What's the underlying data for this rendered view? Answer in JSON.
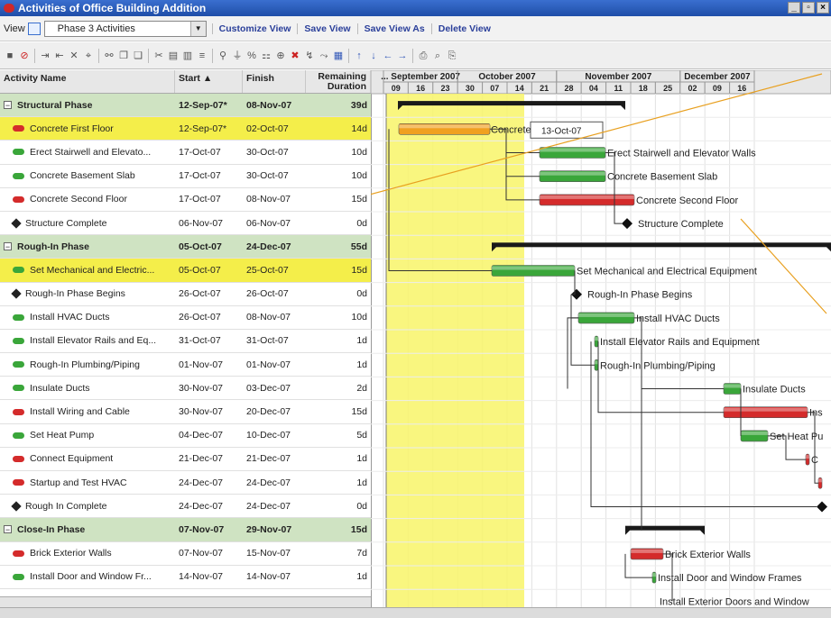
{
  "window": {
    "title": "Activities of Office Building Addition"
  },
  "view": {
    "label": "View",
    "selected": "Phase 3 Activities",
    "links": [
      "Customize View",
      "Save View",
      "Save View As",
      "Delete View"
    ]
  },
  "columns": {
    "activity": "Activity Name",
    "start": "Start",
    "finish": "Finish",
    "remaining": "Remaining Duration"
  },
  "rows": [
    {
      "type": "phase",
      "name": "Structural Phase",
      "start": "12-Sep-07*",
      "finish": "08-Nov-07",
      "dur": "39d"
    },
    {
      "type": "task",
      "icon": "red",
      "name": "Concrete First Floor",
      "start": "12-Sep-07*",
      "finish": "02-Oct-07",
      "dur": "14d",
      "selected": true
    },
    {
      "type": "task",
      "icon": "green",
      "name": "Erect Stairwell and Elevato...",
      "start": "17-Oct-07",
      "finish": "30-Oct-07",
      "dur": "10d"
    },
    {
      "type": "task",
      "icon": "green",
      "name": "Concrete Basement Slab",
      "start": "17-Oct-07",
      "finish": "30-Oct-07",
      "dur": "10d"
    },
    {
      "type": "task",
      "icon": "red",
      "name": "Concrete Second Floor",
      "start": "17-Oct-07",
      "finish": "08-Nov-07",
      "dur": "15d"
    },
    {
      "type": "task",
      "icon": "ms",
      "name": "Structure Complete",
      "start": "06-Nov-07",
      "finish": "06-Nov-07",
      "dur": "0d"
    },
    {
      "type": "phase",
      "name": "Rough-In Phase",
      "start": "05-Oct-07",
      "finish": "24-Dec-07",
      "dur": "55d"
    },
    {
      "type": "task",
      "icon": "green",
      "name": "Set Mechanical and Electric...",
      "start": "05-Oct-07",
      "finish": "25-Oct-07",
      "dur": "15d",
      "selected": true
    },
    {
      "type": "task",
      "icon": "ms",
      "name": "Rough-In Phase Begins",
      "start": "26-Oct-07",
      "finish": "26-Oct-07",
      "dur": "0d"
    },
    {
      "type": "task",
      "icon": "green",
      "name": "Install HVAC Ducts",
      "start": "26-Oct-07",
      "finish": "08-Nov-07",
      "dur": "10d"
    },
    {
      "type": "task",
      "icon": "green",
      "name": "Install Elevator Rails and Eq...",
      "start": "31-Oct-07",
      "finish": "31-Oct-07",
      "dur": "1d"
    },
    {
      "type": "task",
      "icon": "green",
      "name": "Rough-In Plumbing/Piping",
      "start": "01-Nov-07",
      "finish": "01-Nov-07",
      "dur": "1d"
    },
    {
      "type": "task",
      "icon": "green",
      "name": "Insulate Ducts",
      "start": "30-Nov-07",
      "finish": "03-Dec-07",
      "dur": "2d"
    },
    {
      "type": "task",
      "icon": "red",
      "name": "Install Wiring and Cable",
      "start": "30-Nov-07",
      "finish": "20-Dec-07",
      "dur": "15d"
    },
    {
      "type": "task",
      "icon": "green",
      "name": "Set Heat Pump",
      "start": "04-Dec-07",
      "finish": "10-Dec-07",
      "dur": "5d"
    },
    {
      "type": "task",
      "icon": "red",
      "name": "Connect Equipment",
      "start": "21-Dec-07",
      "finish": "21-Dec-07",
      "dur": "1d"
    },
    {
      "type": "task",
      "icon": "red",
      "name": "Startup and Test HVAC",
      "start": "24-Dec-07",
      "finish": "24-Dec-07",
      "dur": "1d"
    },
    {
      "type": "task",
      "icon": "ms",
      "name": "Rough In Complete",
      "start": "24-Dec-07",
      "finish": "24-Dec-07",
      "dur": "0d"
    },
    {
      "type": "phase",
      "name": "Close-In Phase",
      "start": "07-Nov-07",
      "finish": "29-Nov-07",
      "dur": "15d"
    },
    {
      "type": "task",
      "icon": "red",
      "name": "Brick Exterior Walls",
      "start": "07-Nov-07",
      "finish": "15-Nov-07",
      "dur": "7d"
    },
    {
      "type": "task",
      "icon": "green",
      "name": "Install Door and Window Fr...",
      "start": "14-Nov-07",
      "finish": "14-Nov-07",
      "dur": "1d"
    }
  ],
  "timeline": {
    "months": [
      {
        "label": "... September 2007",
        "weeks": [
          "09",
          "16",
          "23"
        ]
      },
      {
        "label": "October 2007",
        "weeks": [
          "30",
          "07",
          "14",
          "21"
        ]
      },
      {
        "label": "November 2007",
        "weeks": [
          "28",
          "04",
          "11",
          "18",
          "25"
        ]
      },
      {
        "label": "December 2007",
        "weeks": [
          "02",
          "09",
          "16"
        ]
      }
    ]
  },
  "gantt_labels": [
    "Concrete",
    "13-Oct-07",
    "Erect Stairwell and Elevator Walls",
    "Concrete Basement Slab",
    "Concrete Second Floor",
    "Structure Complete",
    "Set Mechanical and Electrical Equipment",
    "Rough-In Phase Begins",
    "Install HVAC Ducts",
    "Install Elevator Rails and Equipment",
    "Rough-In Plumbing/Piping",
    "Insulate Ducts",
    "Ins",
    "Set Heat Pu",
    "C",
    "Brick Exterior Walls",
    "Install Door and Window Frames",
    "Install Exterior Doors and Window"
  ],
  "colors": {
    "phase_bg": "#cfe3c2",
    "selected_bg": "#f4ee4a",
    "bar_green": "#3aa63a",
    "bar_red": "#d42b2b",
    "bar_orange": "#f0a020"
  }
}
